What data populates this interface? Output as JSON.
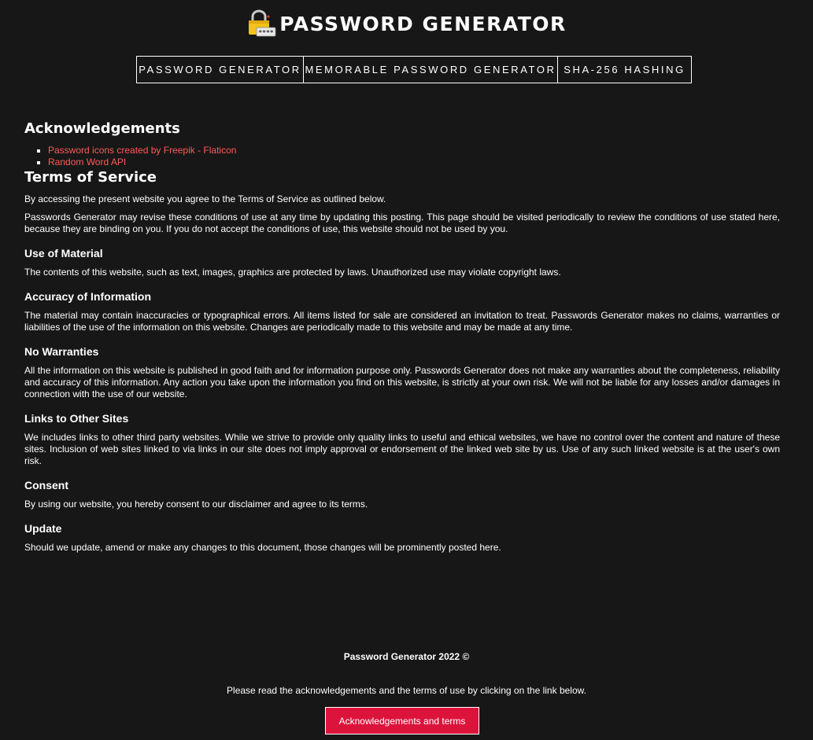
{
  "header": {
    "title": "PASSWORD GENERATOR",
    "logo_icon": "padlock-password-icon",
    "logo_mask_text": "****"
  },
  "nav": {
    "items": [
      {
        "label": "PASSWORD GENERATOR"
      },
      {
        "label": "MEMORABLE PASSWORD GENERATOR"
      },
      {
        "label": "SHA-256 HASHING"
      }
    ]
  },
  "acknowledgements": {
    "title": "Acknowledgements",
    "links": [
      {
        "label": "Password icons created by Freepik - Flaticon"
      },
      {
        "label": "Random Word API"
      }
    ],
    "link_color": "#ff5a5a"
  },
  "terms": {
    "title": "Terms of Service",
    "intro": "By accessing the present website you agree to the Terms of Service as outlined below.",
    "revision": "Passwords Generator may revise these conditions of use at any time by updating this posting. This page should be visited periodically to review the conditions of use stated here, because they are binding on you. If you do not accept the conditions of use, this website should not be used by you.",
    "sections": [
      {
        "heading": "Use of Material",
        "text": "The contents of this website, such as text, images, graphics are protected by laws. Unauthorized use may violate copyright laws."
      },
      {
        "heading": "Accuracy of Information",
        "text": "The material may contain inaccuracies or typographical errors. All items listed for sale are considered an invitation to treat. Passwords Generator makes no claims, warranties or liabilities of the use of the information on this website. Changes are periodically made to this website and may be made at any time."
      },
      {
        "heading": "No Warranties",
        "text": "All the information on this website is published in good faith and for information purpose only. Passwords Generator does not make any warranties about the completeness, reliability and accuracy of this information. Any action you take upon the information you find on this website, is strictly at your own risk. We will not be liable for any losses and/or damages in connection with the use of our website."
      },
      {
        "heading": "Links to Other Sites",
        "text": "We includes links to other third party websites. While we strive to provide only quality links to useful and ethical websites, we have no control over the content and nature of these sites. Inclusion of web sites linked to via links in our site does not imply approval or endorsement of the linked web site by us. Use of any such linked website is at the user's own risk."
      },
      {
        "heading": "Consent",
        "text": "By using our website, you hereby consent to our disclaimer and agree to its terms."
      },
      {
        "heading": "Update",
        "text": "Should we update, amend or make any changes to this document, those changes will be prominently posted here."
      }
    ]
  },
  "footer": {
    "copyright": "Password Generator 2022 ©",
    "note": "Please read the acknowledgements and the terms of use by clicking on the link below.",
    "button_label": "Acknowledgements and terms",
    "button_color": "#dc143c"
  }
}
